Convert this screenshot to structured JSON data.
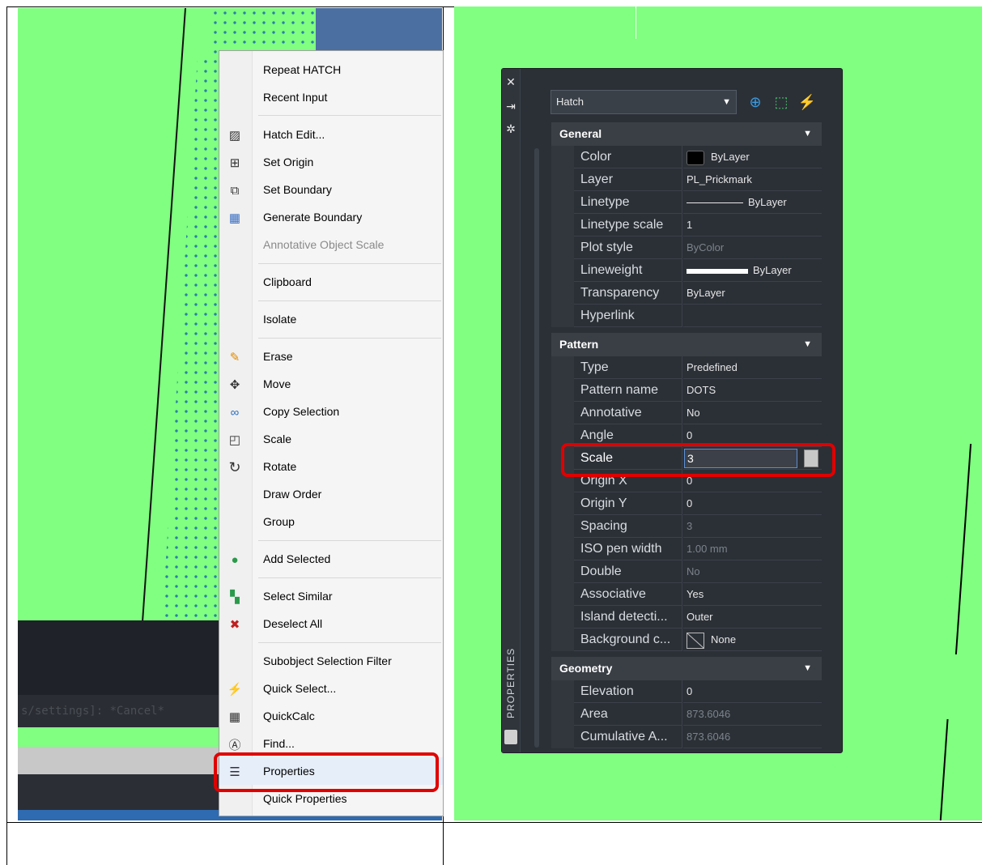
{
  "context_menu": {
    "items": [
      {
        "label": "Repeat HATCH",
        "icon": "",
        "disabled": false
      },
      {
        "label": "Recent Input",
        "icon": "",
        "disabled": false
      },
      {
        "label": "Hatch Edit...",
        "icon": "hatch-edit-icon",
        "disabled": false
      },
      {
        "label": "Set Origin",
        "icon": "set-origin-icon",
        "disabled": false
      },
      {
        "label": "Set Boundary",
        "icon": "set-boundary-icon",
        "disabled": false
      },
      {
        "label": "Generate Boundary",
        "icon": "generate-boundary-icon",
        "disabled": false
      },
      {
        "label": "Annotative Object Scale",
        "icon": "",
        "disabled": true
      },
      {
        "label": "Clipboard",
        "icon": "",
        "disabled": false
      },
      {
        "label": "Isolate",
        "icon": "",
        "disabled": false
      },
      {
        "label": "Erase",
        "icon": "erase-icon",
        "disabled": false
      },
      {
        "label": "Move",
        "icon": "move-icon",
        "disabled": false
      },
      {
        "label": "Copy Selection",
        "icon": "copy-selection-icon",
        "disabled": false
      },
      {
        "label": "Scale",
        "icon": "scale-icon",
        "disabled": false
      },
      {
        "label": "Rotate",
        "icon": "rotate-icon",
        "disabled": false
      },
      {
        "label": "Draw Order",
        "icon": "",
        "disabled": false
      },
      {
        "label": "Group",
        "icon": "",
        "disabled": false
      },
      {
        "label": "Add Selected",
        "icon": "add-selected-icon",
        "disabled": false
      },
      {
        "label": "Select Similar",
        "icon": "select-similar-icon",
        "disabled": false
      },
      {
        "label": "Deselect All",
        "icon": "deselect-all-icon",
        "disabled": false
      },
      {
        "label": "Subobject Selection Filter",
        "icon": "",
        "disabled": false
      },
      {
        "label": "Quick Select...",
        "icon": "quick-select-icon",
        "disabled": false
      },
      {
        "label": "QuickCalc",
        "icon": "quickcalc-icon",
        "disabled": false
      },
      {
        "label": "Find...",
        "icon": "find-icon",
        "disabled": false
      },
      {
        "label": "Properties",
        "icon": "properties-icon",
        "disabled": false
      },
      {
        "label": "Quick Properties",
        "icon": "",
        "disabled": false
      }
    ]
  },
  "command_line": {
    "text": "s/settings]: *Cancel*"
  },
  "properties": {
    "title": "PROPERTIES",
    "object_type": "Hatch",
    "sections": {
      "general": {
        "title": "General",
        "rows": [
          {
            "key": "Color",
            "value": "ByLayer"
          },
          {
            "key": "Layer",
            "value": "PL_Prickmark"
          },
          {
            "key": "Linetype",
            "value": "ByLayer"
          },
          {
            "key": "Linetype scale",
            "value": "1"
          },
          {
            "key": "Plot style",
            "value": "ByColor"
          },
          {
            "key": "Lineweight",
            "value": "ByLayer"
          },
          {
            "key": "Transparency",
            "value": "ByLayer"
          },
          {
            "key": "Hyperlink",
            "value": ""
          }
        ]
      },
      "pattern": {
        "title": "Pattern",
        "rows": [
          {
            "key": "Type",
            "value": "Predefined"
          },
          {
            "key": "Pattern name",
            "value": "DOTS"
          },
          {
            "key": "Annotative",
            "value": "No"
          },
          {
            "key": "Angle",
            "value": "0"
          },
          {
            "key": "Scale",
            "value": "3"
          },
          {
            "key": "Origin X",
            "value": "0"
          },
          {
            "key": "Origin Y",
            "value": "0"
          },
          {
            "key": "Spacing",
            "value": "3"
          },
          {
            "key": "ISO pen width",
            "value": "1.00 mm"
          },
          {
            "key": "Double",
            "value": "No"
          },
          {
            "key": "Associative",
            "value": "Yes"
          },
          {
            "key": "Island detecti...",
            "value": "Outer"
          },
          {
            "key": "Background c...",
            "value": "None"
          }
        ]
      },
      "geometry": {
        "title": "Geometry",
        "rows": [
          {
            "key": "Elevation",
            "value": "0"
          },
          {
            "key": "Area",
            "value": "873.6046"
          },
          {
            "key": "Cumulative A...",
            "value": "873.6046"
          }
        ]
      }
    }
  }
}
